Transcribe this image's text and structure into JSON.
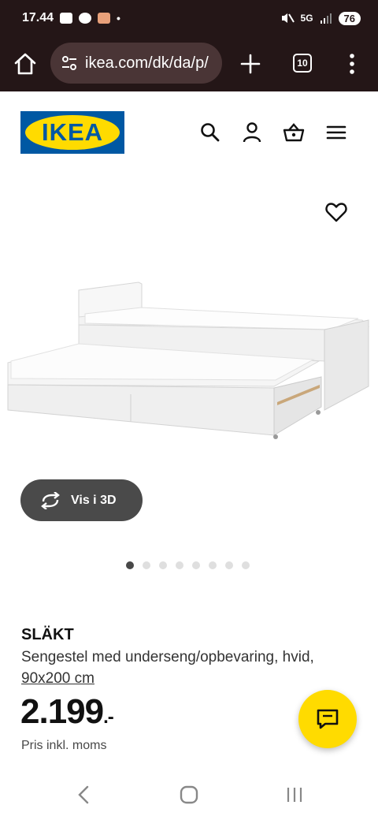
{
  "status_bar": {
    "time": "17.44",
    "network": "5G",
    "battery": "76"
  },
  "browser": {
    "url": "ikea.com/dk/da/p/",
    "tab_count": "10"
  },
  "header": {
    "logo_text": "IKEA",
    "icons": [
      "search-icon",
      "account-icon",
      "basket-icon",
      "hamburger-menu-icon"
    ]
  },
  "product": {
    "view_3d_label": "Vis i 3D",
    "image_count": 8,
    "active_image": 1,
    "name": "SLÄKT",
    "description": "Sengestel med underseng/opbevaring, hvid,",
    "size_link": "90x200 cm",
    "price": "2.199",
    "price_suffix": ".-",
    "price_note": "Pris inkl. moms"
  },
  "colors": {
    "status_bg": "#241617",
    "ikea_blue": "#0058a3",
    "ikea_yellow": "#ffdb00",
    "pill_bg": "#4a4a4a"
  }
}
